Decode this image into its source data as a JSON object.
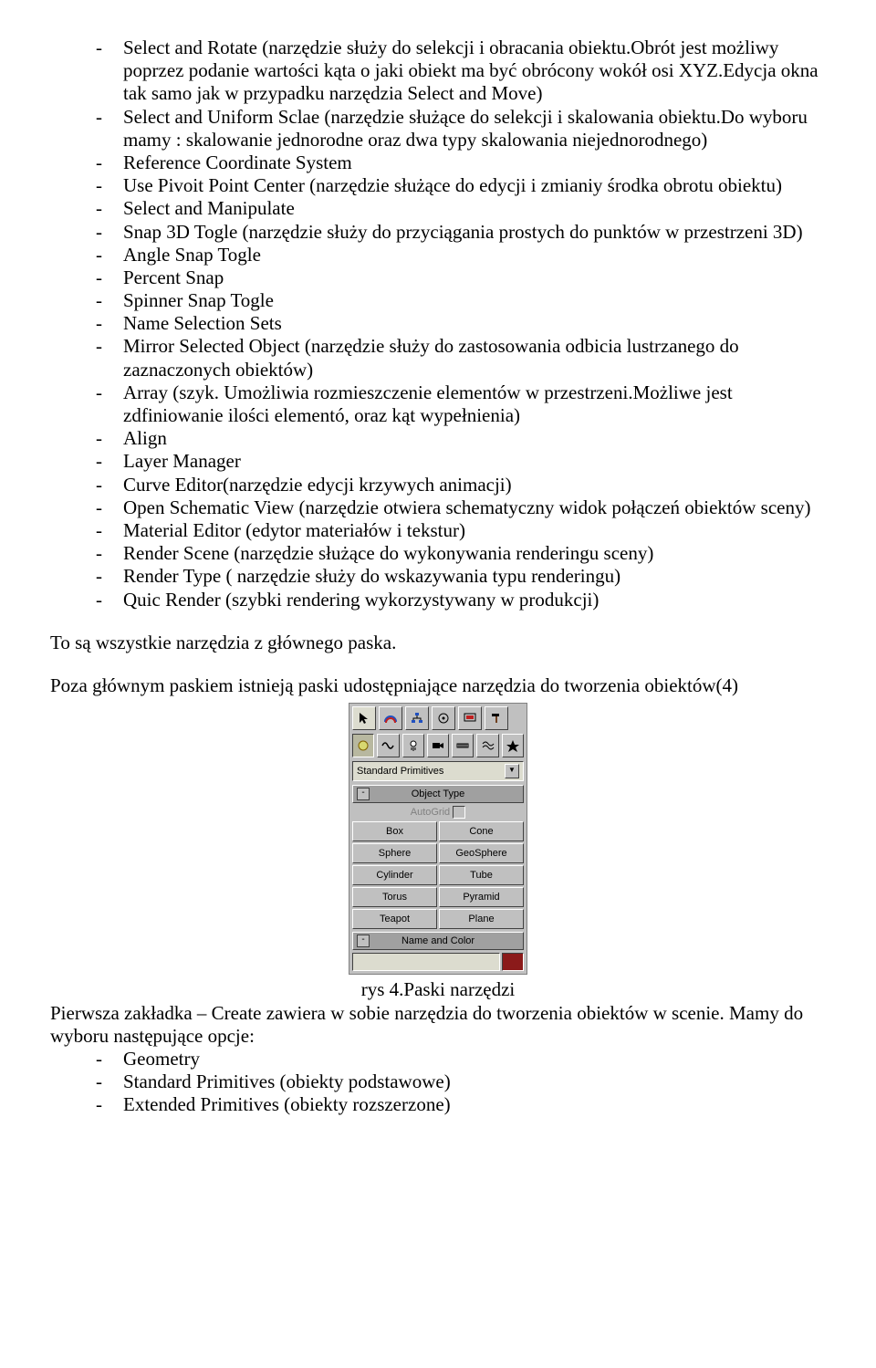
{
  "list_top": [
    "Select and Rotate (narzędzie służy do selekcji i obracania obiektu.Obrót jest możliwy poprzez podanie wartości kąta o jaki obiekt ma być obrócony wokół osi XYZ.Edycja okna tak samo jak w przypadku narzędzia Select and Move)",
    "Select and Uniform Sclae (narzędzie służące do selekcji i skalowania obiektu.Do wyboru mamy : skalowanie jednorodne oraz dwa typy skalowania niejednorodnego)",
    "Reference Coordinate System",
    "Use Pivoit Point Center (narzędzie służące do edycji i zmianiy środka obrotu obiektu)",
    "Select and Manipulate",
    "Snap 3D Togle (narzędzie służy do przyciągania prostych do punktów w przestrzeni 3D)",
    "Angle Snap Togle",
    "Percent Snap",
    "Spinner Snap Togle",
    "Name Selection Sets",
    "Mirror Selected Object (narzędzie służy do zastosowania odbicia lustrzanego do zaznaczonych obiektów)",
    "Array (szyk. Umożliwia rozmieszczenie elementów w przestrzeni.Możliwe jest zdfiniowanie ilości elementó, oraz kąt wypełnienia)",
    "Align",
    "Layer Manager",
    "Curve Editor(narzędzie edycji krzywych animacji)",
    "Open Schematic View (narzędzie otwiera schematyczny widok połączeń obiektów sceny)",
    "Material Editor (edytor materiałów i tekstur)",
    "Render Scene (narzędzie służące do wykonywania renderingu sceny)",
    "Render Type ( narzędzie służy do wskazywania typu renderingu)",
    "Quic Render (szybki rendering wykorzystywany w  produkcji)"
  ],
  "para1": "To są wszystkie narzędzia z głównego paska.",
  "para2": "Poza głównym paskiem istnieją paski udostępniające narzędzia do tworzenia obiektów(4)",
  "panel": {
    "dropdown": "Standard Primitives",
    "rollout_object_type": "Object Type",
    "autogrid": "AutoGrid",
    "buttons": [
      "Box",
      "Cone",
      "Sphere",
      "GeoSphere",
      "Cylinder",
      "Tube",
      "Torus",
      "Pyramid",
      "Teapot",
      "Plane"
    ],
    "rollout_name_color": "Name and Color",
    "color_swatch": "#8b1a1a"
  },
  "caption": "rys 4.Paski narzędzi",
  "para3": "Pierwsza zakładka – Create zawiera w sobie narzędzia do tworzenia obiektów w scenie. Mamy do wyboru następujące opcje:",
  "list_bottom": [
    "Geometry",
    "Standard Primitives (obiekty podstawowe)",
    "Extended Primitives (obiekty rozszerzone)"
  ]
}
